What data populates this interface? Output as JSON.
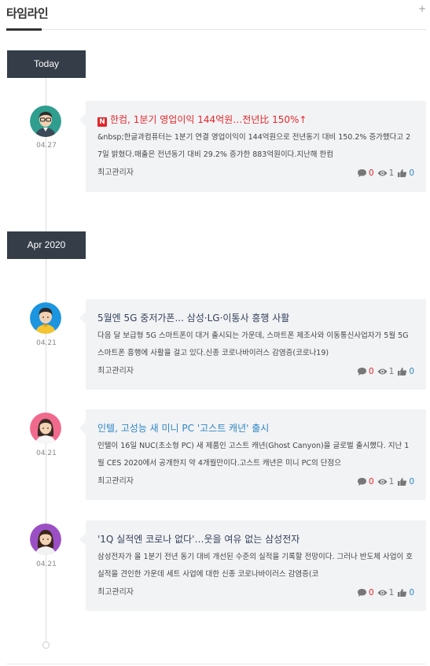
{
  "header": {
    "title": "타임라인",
    "more_symbol": "+"
  },
  "sections": [
    {
      "label": "Today"
    },
    {
      "label": "Apr 2020"
    }
  ],
  "posts": [
    {
      "date": "04.27",
      "badge": "N",
      "title": "한컴, 1분기 영업이익 144억원…전년比 150%↑",
      "body": "&nbsp;한글과컴퓨터는 1분기 연결 영업이익이 144억원으로 전년동기 대비 150.2% 증가했다고 27일 밝혔다.매출은 전년동기 대비 29.2% 증가한 883억원이다.지난해 한컴",
      "author": "최고관리자",
      "comments": "0",
      "views": "1",
      "likes": "0"
    },
    {
      "date": "04.21",
      "title": "5월엔 5G 중저가폰... 삼성·LG·이통사 흥행 사활",
      "body": "다음 달 보급형 5G 스마트폰이 대거 출시되는 가운데, 스마트폰 제조사와 이동통신사업자가 5월 5G 스마트폰 흥행에 사활을 걸고 있다.신종 코로나바이러스 감염증(코로나19)",
      "author": "최고관리자",
      "comments": "0",
      "views": "1",
      "likes": "0"
    },
    {
      "date": "04.21",
      "title": "인텔, 고성능 새 미니 PC '고스트 캐년' 출시",
      "body": "인텔이 16일 NUC(초소형 PC) 새 제품인 고스트 캐년(Ghost Canyon)을 글로벌 출시했다. 지난 1월 CES 2020에서 공개한지 약 4개월만이다.고스트 캐년은 미니 PC의 단점으",
      "author": "최고관리자",
      "comments": "0",
      "views": "1",
      "likes": "0"
    },
    {
      "date": "04.21",
      "title": "'1Q 실적엔 코로나 없다'…웃을 여유 없는 삼성전자",
      "body": "삼성전자가 올 1분기 전년 동기 대비 개선된 수준의 실적을 기록할 전망이다. 그러나 반도체 사업이 호실적을 견인한 가운데 세트 사업에 대한 신종 코로나바이러스 감염증(코",
      "author": "최고관리자",
      "comments": "0",
      "views": "1",
      "likes": "0"
    }
  ],
  "colors": {
    "accent_red": "#e2272a",
    "label_bg": "#343d48",
    "card_bg": "#f2f3f5",
    "link_blue": "#2f86c4"
  },
  "icons": {
    "comment": "comment-icon",
    "view": "eye-icon",
    "like": "thumbs-up-icon"
  }
}
